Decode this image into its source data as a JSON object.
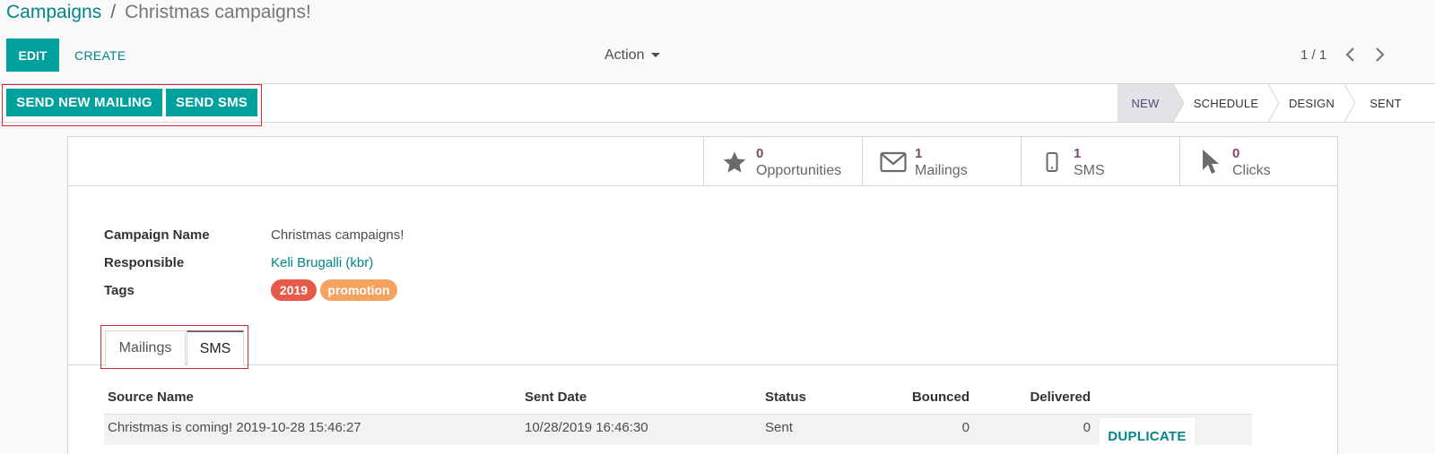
{
  "breadcrumb": {
    "parent": "Campaigns",
    "separator": "/",
    "current": "Christmas campaigns!"
  },
  "control": {
    "edit_label": "EDIT",
    "create_label": "CREATE",
    "action_label": "Action",
    "pager": "1 / 1"
  },
  "header_buttons": {
    "send_mailing": "SEND NEW MAILING",
    "send_sms": "SEND SMS"
  },
  "stages": [
    {
      "label": "NEW",
      "active": true
    },
    {
      "label": "SCHEDULE",
      "active": false
    },
    {
      "label": "DESIGN",
      "active": false
    },
    {
      "label": "SENT",
      "active": false
    }
  ],
  "smart_buttons": [
    {
      "value": "0",
      "label": "Opportunities",
      "icon": "star-icon"
    },
    {
      "value": "1",
      "label": "Mailings",
      "icon": "envelope-icon"
    },
    {
      "value": "1",
      "label": "SMS",
      "icon": "mobile-icon"
    },
    {
      "value": "0",
      "label": "Clicks",
      "icon": "cursor-icon"
    }
  ],
  "fields": {
    "campaign_name_label": "Campaign Name",
    "campaign_name": "Christmas campaigns!",
    "responsible_label": "Responsible",
    "responsible": "Keli Brugalli (kbr)",
    "tags_label": "Tags",
    "tags": [
      {
        "name": "2019",
        "color": "#e65a4a"
      },
      {
        "name": "promotion",
        "color": "#f4a460"
      }
    ]
  },
  "tabs": [
    {
      "label": "Mailings",
      "active": false
    },
    {
      "label": "SMS",
      "active": true
    }
  ],
  "table": {
    "columns": [
      "Source Name",
      "Sent Date",
      "Status",
      "Bounced",
      "Delivered"
    ],
    "rows": [
      {
        "source": "Christmas is coming! 2019-10-28 15:46:27",
        "sent_date": "10/28/2019 16:46:30",
        "status": "Sent",
        "bounced": "0",
        "delivered": "0",
        "action": "DUPLICATE"
      }
    ]
  },
  "colors": {
    "primary": "#00a09d",
    "link": "#00868b",
    "highlight_box": "#e0262d",
    "smart_value": "#7c4a6a"
  }
}
